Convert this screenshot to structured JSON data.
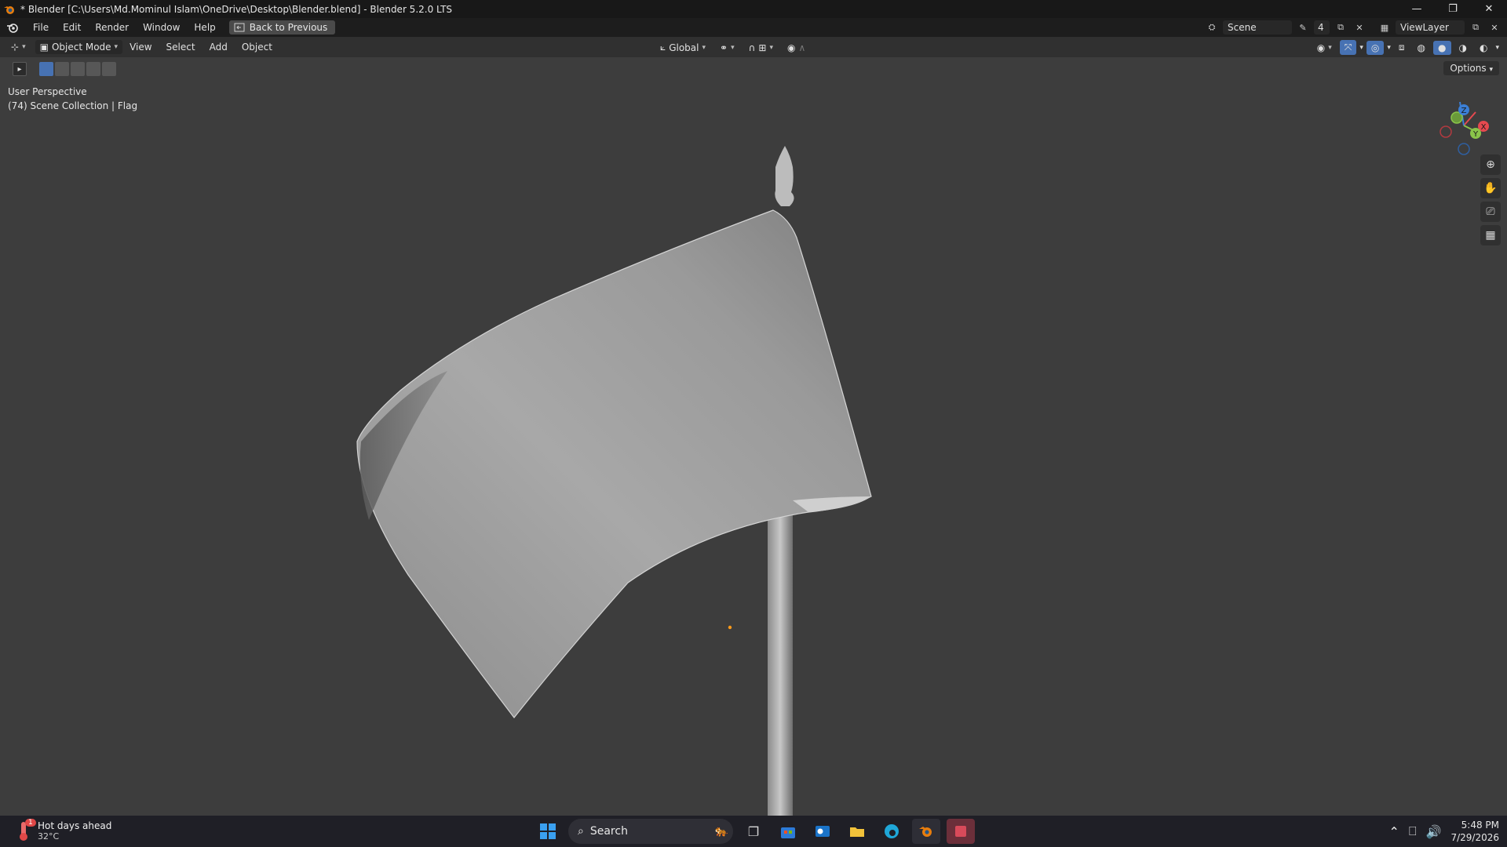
{
  "window": {
    "title": "* Blender [C:\\Users\\Md.Mominul Islam\\OneDrive\\Desktop\\Blender.blend] - Blender 5.2.0 LTS",
    "min": "—",
    "max": "❐",
    "close": "✕"
  },
  "menu": {
    "items": [
      "File",
      "Edit",
      "Render",
      "Window",
      "Help"
    ],
    "back_label": "Back to Previous",
    "scene_label": "Scene",
    "scene_users": "4",
    "viewlayer_label": "ViewLayer"
  },
  "header": {
    "mode": "Object Mode",
    "items": [
      "View",
      "Select",
      "Add",
      "Object"
    ],
    "orientation": "Global"
  },
  "viewport": {
    "perspective": "User Perspective",
    "collection": "(74) Scene Collection | Flag",
    "options": "Options",
    "gizmo": {
      "x": "X",
      "y": "Y",
      "z": "Z"
    }
  },
  "taskbar": {
    "weather_title": "Hot days ahead",
    "weather_temp": "32°C",
    "weather_badge": "1",
    "search": "Search",
    "time": "5:48 PM",
    "date": "7/29/2026"
  },
  "colors": {
    "x_axis": "#e5494f",
    "y_axis": "#8ac44a",
    "z_axis": "#3b7fd6",
    "accent": "#4772b3",
    "viewport_bg": "#3d3d3d"
  }
}
